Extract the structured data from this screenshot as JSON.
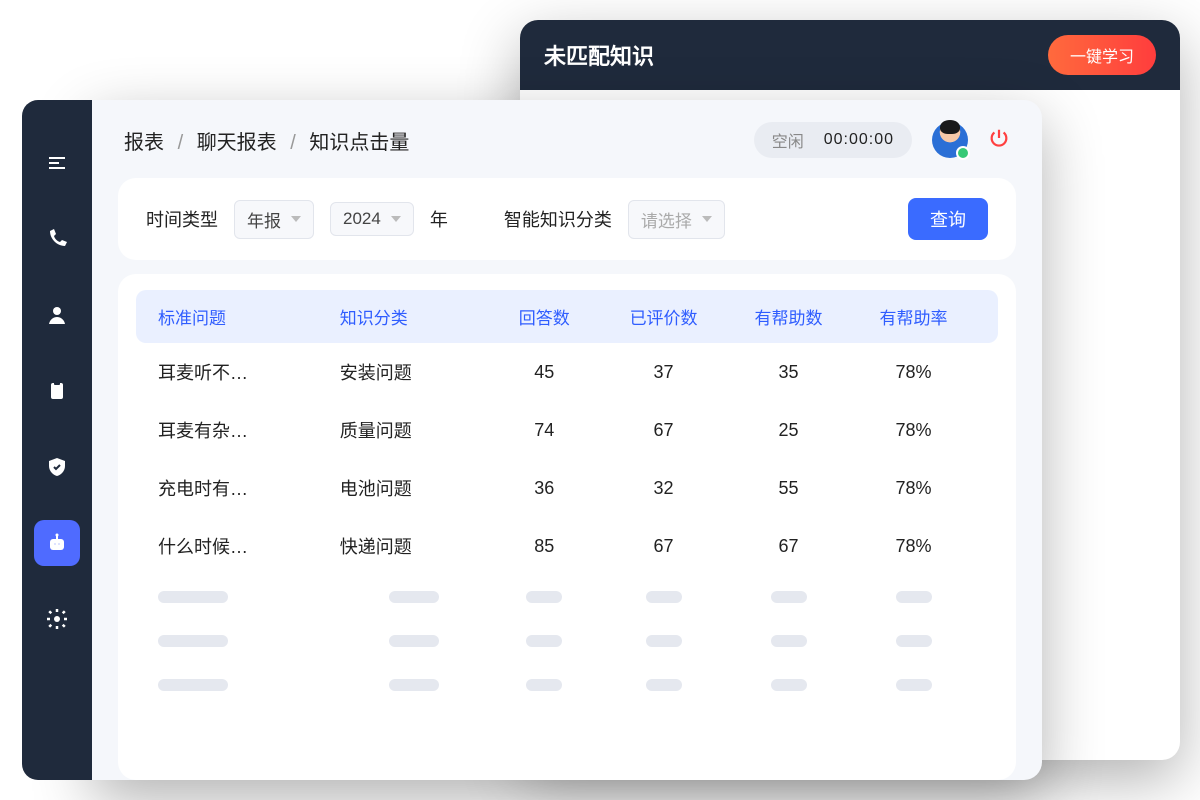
{
  "back": {
    "title": "未匹配知识",
    "learn_btn": "一键学习"
  },
  "breadcrumb": {
    "root": "报表",
    "mid": "聊天报表",
    "leaf": "知识点击量"
  },
  "status": {
    "label": "空闲",
    "time": "00:00:00"
  },
  "filter": {
    "time_type_label": "时间类型",
    "time_type_value": "年报",
    "year_value": "2024",
    "year_suffix": "年",
    "category_label": "智能知识分类",
    "category_placeholder": "请选择",
    "query_btn": "查询"
  },
  "table": {
    "headers": {
      "question": "标准问题",
      "category": "知识分类",
      "answers": "回答数",
      "rated": "已评价数",
      "helpful": "有帮助数",
      "helpful_rate": "有帮助率"
    },
    "rows": [
      {
        "question": "耳麦听不…",
        "category": "安装问题",
        "answers": "45",
        "rated": "37",
        "helpful": "35",
        "helpful_rate": "78%"
      },
      {
        "question": "耳麦有杂…",
        "category": "质量问题",
        "answers": "74",
        "rated": "67",
        "helpful": "25",
        "helpful_rate": "78%"
      },
      {
        "question": "充电时有…",
        "category": "电池问题",
        "answers": "36",
        "rated": "32",
        "helpful": "55",
        "helpful_rate": "78%"
      },
      {
        "question": "什么时候…",
        "category": "快递问题",
        "answers": "85",
        "rated": "67",
        "helpful": "67",
        "helpful_rate": "78%"
      }
    ]
  }
}
